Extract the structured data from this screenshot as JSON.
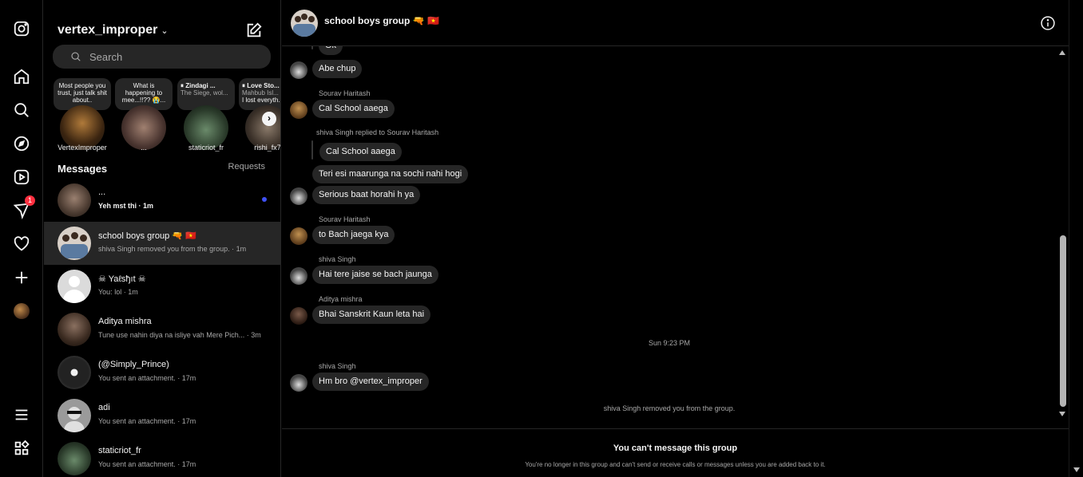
{
  "rail": {
    "notifications_count": "1"
  },
  "inbox": {
    "username": "vertex_improper",
    "search_placeholder": "Search",
    "messages_label": "Messages",
    "requests_label": "Requests",
    "notes": [
      {
        "text": "Most people you trust, just talk shit about..",
        "name": "VertexImproper"
      },
      {
        "text": "What is happening to mee...!!?? 😭...",
        "name": "..."
      },
      {
        "title": "⏸ Zindagi ...",
        "subtitle": "The Siege, wol...",
        "name": "staticriot_fr"
      },
      {
        "title": "⏸ Love Sto...",
        "subtitle": "Mahbub Isl...",
        "extra": "I lost everyth...",
        "name": "rishi_fx7"
      }
    ],
    "conversations": [
      {
        "name": "...",
        "preview": "Yeh mst thi · 1m",
        "unread": true
      },
      {
        "name": "school boys group 🔫 🇻🇳",
        "preview": "shiva Singh removed you from the group. · 1m"
      },
      {
        "name": "☠ Yaℓѕђıt ☠",
        "preview": "You: lol · 1m"
      },
      {
        "name": "Aditya mishra",
        "preview": "Tune use nahin diya na isliye vah Mere Pich... · 3m"
      },
      {
        "name": "(@Simply_Prince)",
        "preview": "You sent an attachment. · 17m"
      },
      {
        "name": "adi",
        "preview": "You sent an attachment. · 17m"
      },
      {
        "name": "staticriot_fr",
        "preview": "You sent an attachment. · 17m"
      }
    ]
  },
  "chat": {
    "title": "school boys group 🔫 🇻🇳",
    "messages": {
      "m0": "Ok",
      "m1": "Abe chup",
      "s2": "Sourav Haritash",
      "m2": "Cal School aaega",
      "s3": "shiva Singh replied to Sourav Haritash",
      "r3": "Cal School aaega",
      "m3": "Teri esi maarunga na sochi nahi hogi",
      "m4": "Serious baat horahi h ya",
      "s5": "Sourav Haritash",
      "m5": "to Bach jaega kya",
      "s6": "shiva Singh",
      "m6": "Hai tere jaise se bach jaunga",
      "s7": "Aditya mishra",
      "m7": "Bhai Sanskrit Kaun leta hai",
      "stamp": "Sun 9:23 PM",
      "s8": "shiva Singh",
      "m8": "Hm bro @vertex_improper",
      "system": "shiva Singh removed you from the group."
    },
    "footer_title": "You can't message this group",
    "footer_sub": "You're no longer in this group and can't send or receive calls or messages unless you are added back to it."
  }
}
